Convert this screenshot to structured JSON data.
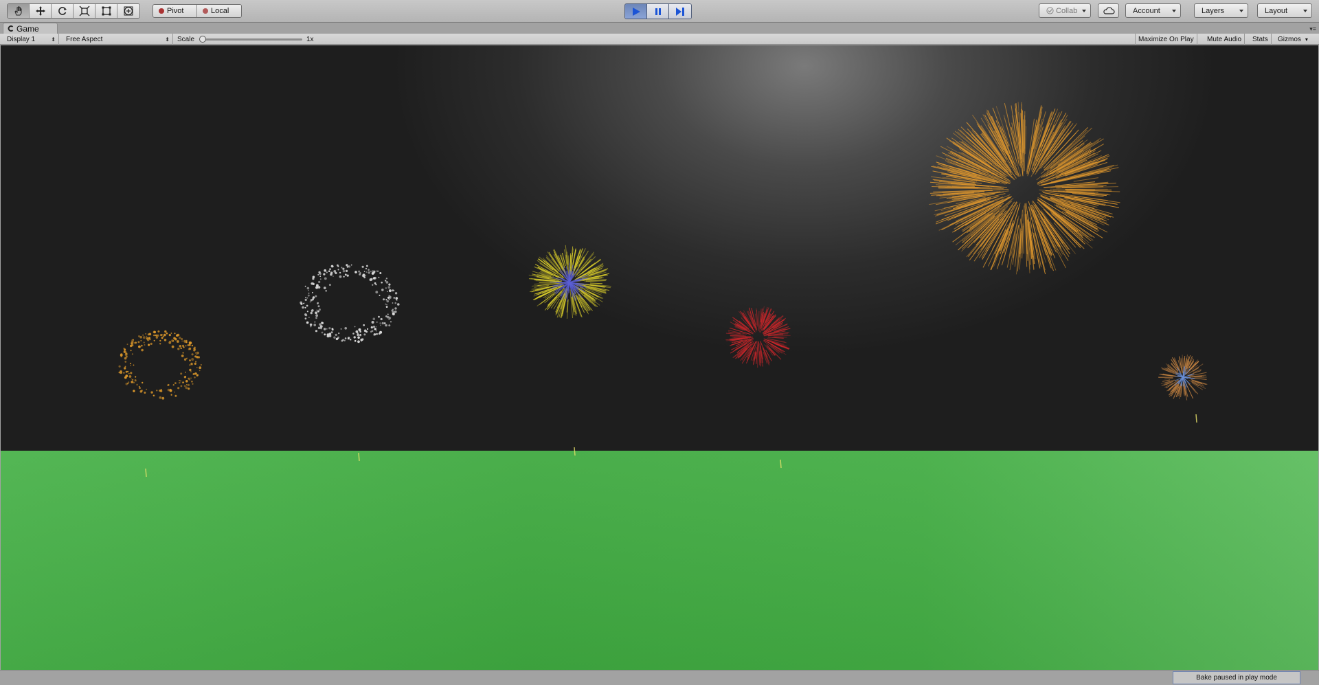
{
  "toolbar": {
    "tools": [
      "hand-tool",
      "move-tool",
      "rotate-tool",
      "scale-tool",
      "rect-tool",
      "transform-tool"
    ],
    "pivot_label": "Pivot",
    "local_label": "Local",
    "playback": {
      "play": "play-icon",
      "pause": "pause-icon",
      "step": "step-icon"
    },
    "collab_label": "Collab",
    "account_label": "Account",
    "layers_label": "Layers",
    "layout_label": "Layout"
  },
  "game_tab": {
    "title": "Game"
  },
  "game_bar": {
    "display_label": "Display 1",
    "aspect_label": "Free Aspect",
    "scale_label": "Scale",
    "scale_value": "1x",
    "scale_fraction": 0.0,
    "maximize_label": "Maximize On Play",
    "mute_label": "Mute Audio",
    "stats_label": "Stats",
    "gizmos_label": "Gizmos"
  },
  "scene": {
    "sky_color": "#1e1e1e",
    "ground_color": "#44ae45",
    "fireworks": [
      {
        "name": "orange-firework",
        "color": "#d9962a"
      },
      {
        "name": "white-firework",
        "color": "#dcdcdc"
      },
      {
        "name": "yellow-blue-firework",
        "color": "#d8cc2a"
      },
      {
        "name": "red-firework",
        "color": "#c8262a"
      },
      {
        "name": "large-orange-firework",
        "color": "#e0982e"
      },
      {
        "name": "small-multicolor-firework",
        "color": "#c08040"
      }
    ]
  },
  "status": {
    "bake_message": "Bake paused in play mode"
  }
}
